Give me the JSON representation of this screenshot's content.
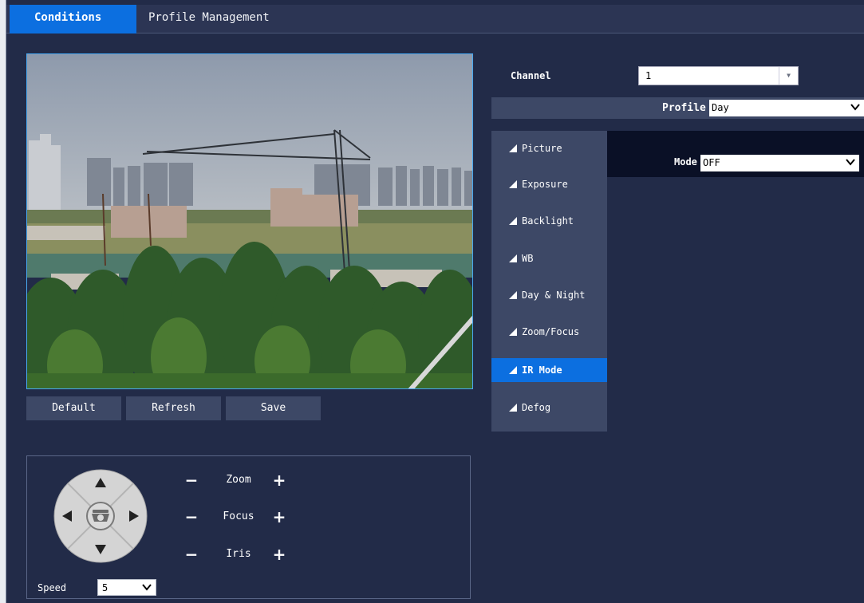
{
  "tabs": [
    {
      "label": "Conditions",
      "active": true
    },
    {
      "label": "Profile Management",
      "active": false
    }
  ],
  "preview": {
    "icon": "camera-live-view"
  },
  "actions": {
    "default_label": "Default",
    "refresh_label": "Refresh",
    "save_label": "Save"
  },
  "ptz": {
    "zoom_label": "Zoom",
    "focus_label": "Focus",
    "iris_label": "Iris",
    "speed_label": "Speed",
    "speed_value": "5"
  },
  "channel": {
    "label": "Channel",
    "value": "1"
  },
  "profile": {
    "label": "Profile",
    "value": "Day"
  },
  "menu": {
    "items": [
      {
        "label": "Picture"
      },
      {
        "label": "Exposure"
      },
      {
        "label": "Backlight"
      },
      {
        "label": "WB"
      },
      {
        "label": "Day & Night"
      },
      {
        "label": "Zoom/Focus"
      },
      {
        "label": "IR Mode",
        "active": true
      },
      {
        "label": "Defog"
      }
    ]
  },
  "ir_mode": {
    "label": "Mode",
    "value": "OFF"
  },
  "colors": {
    "background": "#222b48",
    "accent": "#0c6fe0",
    "panel": "#3d4866",
    "mode_panel": "#0a1026"
  }
}
